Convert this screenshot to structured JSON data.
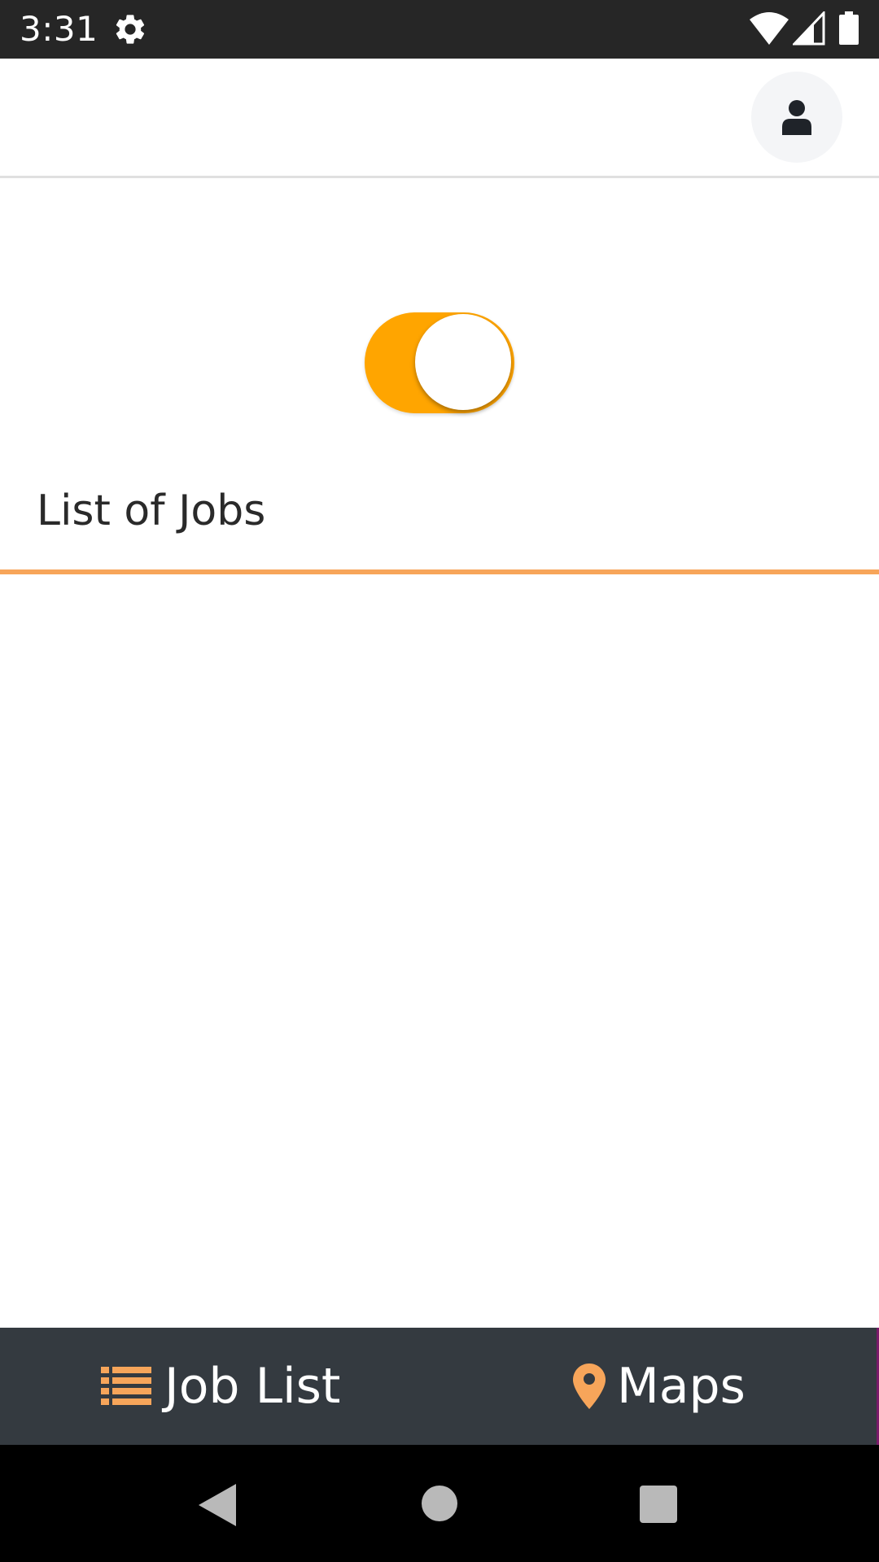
{
  "status_bar": {
    "time": "3:31",
    "icons": [
      "gear-icon",
      "wifi-icon",
      "signal-icon",
      "battery-icon"
    ]
  },
  "header": {
    "profile_icon": "user-icon"
  },
  "toggle": {
    "state": "on",
    "color": "#ffa500"
  },
  "main": {
    "section_title": "List of Jobs",
    "accent_color": "#f7a55a",
    "jobs": []
  },
  "tab_bar": {
    "tabs": [
      {
        "label": "Job List",
        "icon": "list-icon",
        "icon_color": "#f7a55a"
      },
      {
        "label": "Maps",
        "icon": "map-pin-icon",
        "icon_color": "#f7a55a"
      }
    ],
    "background": "#343a40"
  },
  "nav_bar": {
    "buttons": [
      "back-icon",
      "home-icon",
      "recents-icon"
    ]
  }
}
